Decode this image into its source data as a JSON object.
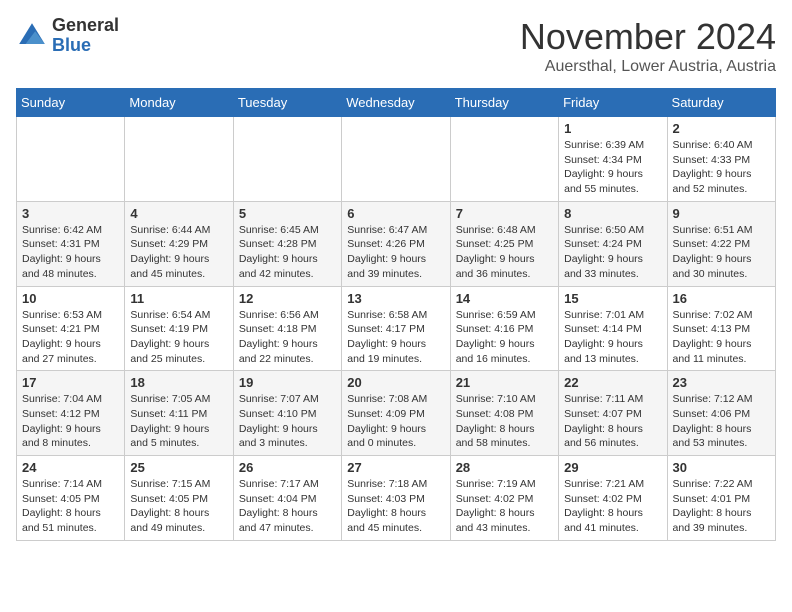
{
  "logo": {
    "general": "General",
    "blue": "Blue"
  },
  "header": {
    "month": "November 2024",
    "location": "Auersthal, Lower Austria, Austria"
  },
  "weekdays": [
    "Sunday",
    "Monday",
    "Tuesday",
    "Wednesday",
    "Thursday",
    "Friday",
    "Saturday"
  ],
  "weeks": [
    [
      {
        "day": "",
        "info": ""
      },
      {
        "day": "",
        "info": ""
      },
      {
        "day": "",
        "info": ""
      },
      {
        "day": "",
        "info": ""
      },
      {
        "day": "",
        "info": ""
      },
      {
        "day": "1",
        "info": "Sunrise: 6:39 AM\nSunset: 4:34 PM\nDaylight: 9 hours and 55 minutes."
      },
      {
        "day": "2",
        "info": "Sunrise: 6:40 AM\nSunset: 4:33 PM\nDaylight: 9 hours and 52 minutes."
      }
    ],
    [
      {
        "day": "3",
        "info": "Sunrise: 6:42 AM\nSunset: 4:31 PM\nDaylight: 9 hours and 48 minutes."
      },
      {
        "day": "4",
        "info": "Sunrise: 6:44 AM\nSunset: 4:29 PM\nDaylight: 9 hours and 45 minutes."
      },
      {
        "day": "5",
        "info": "Sunrise: 6:45 AM\nSunset: 4:28 PM\nDaylight: 9 hours and 42 minutes."
      },
      {
        "day": "6",
        "info": "Sunrise: 6:47 AM\nSunset: 4:26 PM\nDaylight: 9 hours and 39 minutes."
      },
      {
        "day": "7",
        "info": "Sunrise: 6:48 AM\nSunset: 4:25 PM\nDaylight: 9 hours and 36 minutes."
      },
      {
        "day": "8",
        "info": "Sunrise: 6:50 AM\nSunset: 4:24 PM\nDaylight: 9 hours and 33 minutes."
      },
      {
        "day": "9",
        "info": "Sunrise: 6:51 AM\nSunset: 4:22 PM\nDaylight: 9 hours and 30 minutes."
      }
    ],
    [
      {
        "day": "10",
        "info": "Sunrise: 6:53 AM\nSunset: 4:21 PM\nDaylight: 9 hours and 27 minutes."
      },
      {
        "day": "11",
        "info": "Sunrise: 6:54 AM\nSunset: 4:19 PM\nDaylight: 9 hours and 25 minutes."
      },
      {
        "day": "12",
        "info": "Sunrise: 6:56 AM\nSunset: 4:18 PM\nDaylight: 9 hours and 22 minutes."
      },
      {
        "day": "13",
        "info": "Sunrise: 6:58 AM\nSunset: 4:17 PM\nDaylight: 9 hours and 19 minutes."
      },
      {
        "day": "14",
        "info": "Sunrise: 6:59 AM\nSunset: 4:16 PM\nDaylight: 9 hours and 16 minutes."
      },
      {
        "day": "15",
        "info": "Sunrise: 7:01 AM\nSunset: 4:14 PM\nDaylight: 9 hours and 13 minutes."
      },
      {
        "day": "16",
        "info": "Sunrise: 7:02 AM\nSunset: 4:13 PM\nDaylight: 9 hours and 11 minutes."
      }
    ],
    [
      {
        "day": "17",
        "info": "Sunrise: 7:04 AM\nSunset: 4:12 PM\nDaylight: 9 hours and 8 minutes."
      },
      {
        "day": "18",
        "info": "Sunrise: 7:05 AM\nSunset: 4:11 PM\nDaylight: 9 hours and 5 minutes."
      },
      {
        "day": "19",
        "info": "Sunrise: 7:07 AM\nSunset: 4:10 PM\nDaylight: 9 hours and 3 minutes."
      },
      {
        "day": "20",
        "info": "Sunrise: 7:08 AM\nSunset: 4:09 PM\nDaylight: 9 hours and 0 minutes."
      },
      {
        "day": "21",
        "info": "Sunrise: 7:10 AM\nSunset: 4:08 PM\nDaylight: 8 hours and 58 minutes."
      },
      {
        "day": "22",
        "info": "Sunrise: 7:11 AM\nSunset: 4:07 PM\nDaylight: 8 hours and 56 minutes."
      },
      {
        "day": "23",
        "info": "Sunrise: 7:12 AM\nSunset: 4:06 PM\nDaylight: 8 hours and 53 minutes."
      }
    ],
    [
      {
        "day": "24",
        "info": "Sunrise: 7:14 AM\nSunset: 4:05 PM\nDaylight: 8 hours and 51 minutes."
      },
      {
        "day": "25",
        "info": "Sunrise: 7:15 AM\nSunset: 4:05 PM\nDaylight: 8 hours and 49 minutes."
      },
      {
        "day": "26",
        "info": "Sunrise: 7:17 AM\nSunset: 4:04 PM\nDaylight: 8 hours and 47 minutes."
      },
      {
        "day": "27",
        "info": "Sunrise: 7:18 AM\nSunset: 4:03 PM\nDaylight: 8 hours and 45 minutes."
      },
      {
        "day": "28",
        "info": "Sunrise: 7:19 AM\nSunset: 4:02 PM\nDaylight: 8 hours and 43 minutes."
      },
      {
        "day": "29",
        "info": "Sunrise: 7:21 AM\nSunset: 4:02 PM\nDaylight: 8 hours and 41 minutes."
      },
      {
        "day": "30",
        "info": "Sunrise: 7:22 AM\nSunset: 4:01 PM\nDaylight: 8 hours and 39 minutes."
      }
    ]
  ]
}
